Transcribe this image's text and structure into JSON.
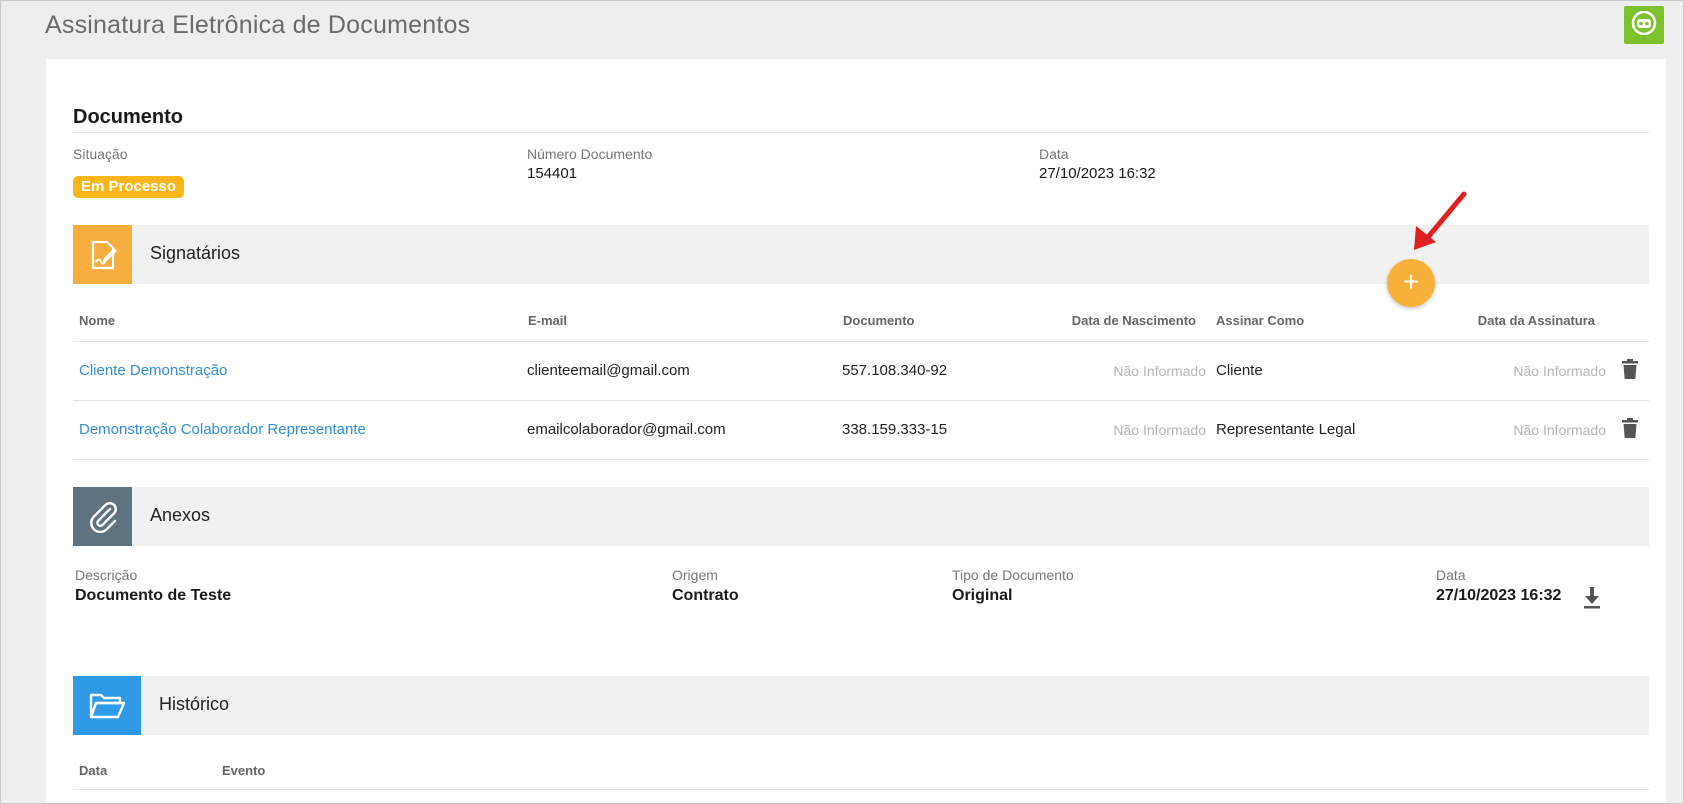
{
  "app": {
    "title": "Assinatura Eletrônica de Documentos"
  },
  "document": {
    "heading": "Documento",
    "situacao_label": "Situação",
    "situacao_value": "Em Processo",
    "numero_label": "Número Documento",
    "numero_value": "154401",
    "data_label": "Data",
    "data_value": "27/10/2023 16:32"
  },
  "signatarios": {
    "title": "Signatários",
    "add_label": "+",
    "columns": [
      "Nome",
      "E-mail",
      "Documento",
      "Data de Nascimento",
      "Assinar Como",
      "Data da Assinatura"
    ],
    "rows": [
      {
        "nome": "Cliente Demonstração",
        "email": "clienteemail@gmail.com",
        "documento": "557.108.340-92",
        "nascimento": "Não Informado",
        "assinar_como": "Cliente",
        "data_assinatura": "Não Informado"
      },
      {
        "nome": "Demonstração Colaborador Representante",
        "email": "emailcolaborador@gmail.com",
        "documento": "338.159.333-15",
        "nascimento": "Não Informado",
        "assinar_como": "Representante Legal",
        "data_assinatura": "Não Informado"
      }
    ]
  },
  "anexos": {
    "title": "Anexos",
    "descricao_label": "Descrição",
    "descricao_value": "Documento de Teste",
    "origem_label": "Origem",
    "origem_value": "Contrato",
    "tipo_label": "Tipo de Documento",
    "tipo_value": "Original",
    "data_label": "Data",
    "data_value": "27/10/2023 16:32"
  },
  "historico": {
    "title": "Histórico",
    "columns": [
      "Data",
      "Evento"
    ]
  },
  "colors": {
    "accent_green": "#7cc22f",
    "badge_yellow": "#fbb617",
    "signatarios_orange": "#f8ad3f",
    "anexos_slate": "#5f7280",
    "historico_blue": "#2e9ae8",
    "link_blue": "#2f8fd8"
  },
  "icons": {
    "top_button": "robot-face-icon",
    "signatarios": "signature-document-icon",
    "anexos": "paperclip-icon",
    "historico": "folder-open-icon",
    "delete": "trash-icon",
    "download": "download-icon"
  }
}
